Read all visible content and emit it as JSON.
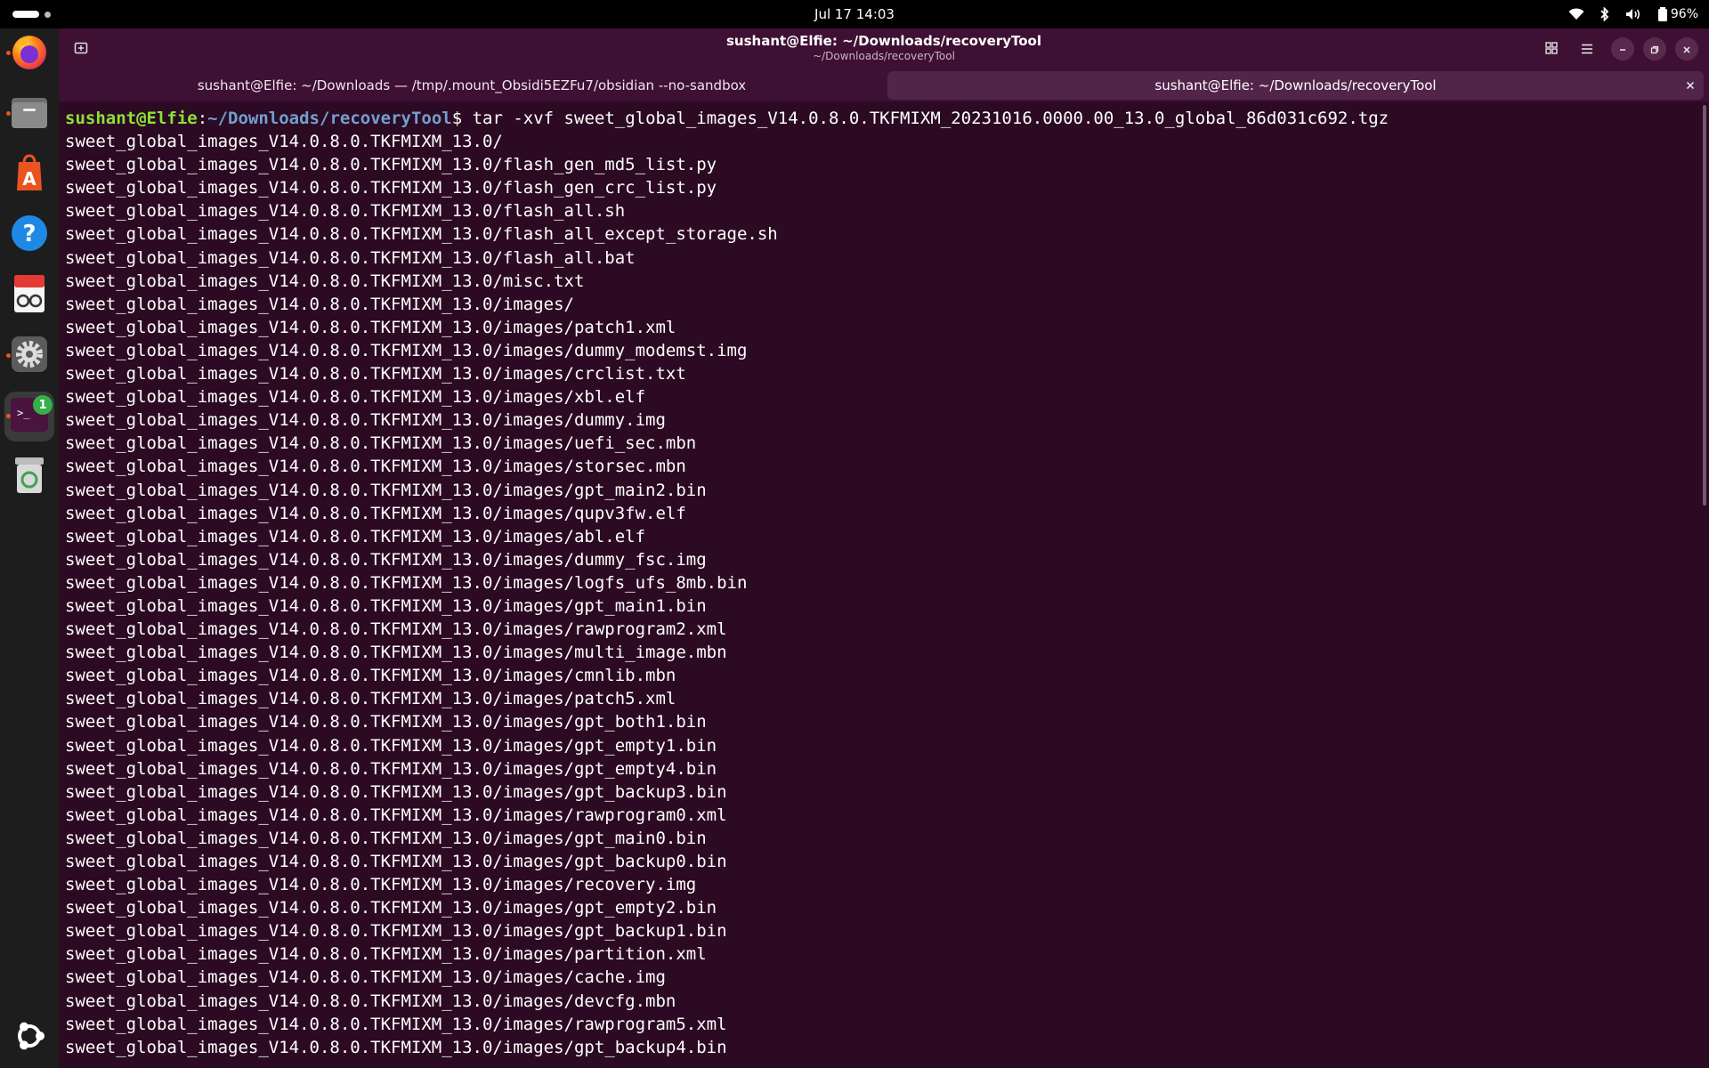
{
  "topbar": {
    "clock": "Jul 17  14:03",
    "battery": "96%",
    "icons": [
      "wifi-icon",
      "bluetooth-icon",
      "volume-icon",
      "battery-icon"
    ]
  },
  "dock": {
    "items": [
      "firefox-icon",
      "files-icon",
      "app-center-icon",
      "help-icon",
      "document-viewer-icon",
      "settings-icon",
      "terminal-icon",
      "trash-icon",
      "ubuntu-logo-icon"
    ],
    "terminal_badge": "1"
  },
  "window": {
    "title": "sushant@Elfie: ~/Downloads/recoveryTool",
    "subtitle": "~/Downloads/recoveryTool",
    "tabs": [
      {
        "label": "sushant@Elfie: ~/Downloads — /tmp/.mount_Obsidi5EZFu7/obsidian --no-sandbox"
      },
      {
        "label": "sushant@Elfie: ~/Downloads/recoveryTool"
      }
    ]
  },
  "terminal": {
    "prompt_user": "sushant@Elfie",
    "prompt_sep": ":",
    "prompt_path": "~/Downloads/recoveryTool",
    "prompt_end": "$ ",
    "command": "tar -xvf sweet_global_images_V14.0.8.0.TKFMIXM_20231016.0000.00_13.0_global_86d031c692.tgz",
    "output": [
      "sweet_global_images_V14.0.8.0.TKFMIXM_13.0/",
      "sweet_global_images_V14.0.8.0.TKFMIXM_13.0/flash_gen_md5_list.py",
      "sweet_global_images_V14.0.8.0.TKFMIXM_13.0/flash_gen_crc_list.py",
      "sweet_global_images_V14.0.8.0.TKFMIXM_13.0/flash_all.sh",
      "sweet_global_images_V14.0.8.0.TKFMIXM_13.0/flash_all_except_storage.sh",
      "sweet_global_images_V14.0.8.0.TKFMIXM_13.0/flash_all.bat",
      "sweet_global_images_V14.0.8.0.TKFMIXM_13.0/misc.txt",
      "sweet_global_images_V14.0.8.0.TKFMIXM_13.0/images/",
      "sweet_global_images_V14.0.8.0.TKFMIXM_13.0/images/patch1.xml",
      "sweet_global_images_V14.0.8.0.TKFMIXM_13.0/images/dummy_modemst.img",
      "sweet_global_images_V14.0.8.0.TKFMIXM_13.0/images/crclist.txt",
      "sweet_global_images_V14.0.8.0.TKFMIXM_13.0/images/xbl.elf",
      "sweet_global_images_V14.0.8.0.TKFMIXM_13.0/images/dummy.img",
      "sweet_global_images_V14.0.8.0.TKFMIXM_13.0/images/uefi_sec.mbn",
      "sweet_global_images_V14.0.8.0.TKFMIXM_13.0/images/storsec.mbn",
      "sweet_global_images_V14.0.8.0.TKFMIXM_13.0/images/gpt_main2.bin",
      "sweet_global_images_V14.0.8.0.TKFMIXM_13.0/images/qupv3fw.elf",
      "sweet_global_images_V14.0.8.0.TKFMIXM_13.0/images/abl.elf",
      "sweet_global_images_V14.0.8.0.TKFMIXM_13.0/images/dummy_fsc.img",
      "sweet_global_images_V14.0.8.0.TKFMIXM_13.0/images/logfs_ufs_8mb.bin",
      "sweet_global_images_V14.0.8.0.TKFMIXM_13.0/images/gpt_main1.bin",
      "sweet_global_images_V14.0.8.0.TKFMIXM_13.0/images/rawprogram2.xml",
      "sweet_global_images_V14.0.8.0.TKFMIXM_13.0/images/multi_image.mbn",
      "sweet_global_images_V14.0.8.0.TKFMIXM_13.0/images/cmnlib.mbn",
      "sweet_global_images_V14.0.8.0.TKFMIXM_13.0/images/patch5.xml",
      "sweet_global_images_V14.0.8.0.TKFMIXM_13.0/images/gpt_both1.bin",
      "sweet_global_images_V14.0.8.0.TKFMIXM_13.0/images/gpt_empty1.bin",
      "sweet_global_images_V14.0.8.0.TKFMIXM_13.0/images/gpt_empty4.bin",
      "sweet_global_images_V14.0.8.0.TKFMIXM_13.0/images/gpt_backup3.bin",
      "sweet_global_images_V14.0.8.0.TKFMIXM_13.0/images/rawprogram0.xml",
      "sweet_global_images_V14.0.8.0.TKFMIXM_13.0/images/gpt_main0.bin",
      "sweet_global_images_V14.0.8.0.TKFMIXM_13.0/images/gpt_backup0.bin",
      "sweet_global_images_V14.0.8.0.TKFMIXM_13.0/images/recovery.img",
      "sweet_global_images_V14.0.8.0.TKFMIXM_13.0/images/gpt_empty2.bin",
      "sweet_global_images_V14.0.8.0.TKFMIXM_13.0/images/gpt_backup1.bin",
      "sweet_global_images_V14.0.8.0.TKFMIXM_13.0/images/partition.xml",
      "sweet_global_images_V14.0.8.0.TKFMIXM_13.0/images/cache.img",
      "sweet_global_images_V14.0.8.0.TKFMIXM_13.0/images/devcfg.mbn",
      "sweet_global_images_V14.0.8.0.TKFMIXM_13.0/images/rawprogram5.xml",
      "sweet_global_images_V14.0.8.0.TKFMIXM_13.0/images/gpt_backup4.bin"
    ]
  }
}
